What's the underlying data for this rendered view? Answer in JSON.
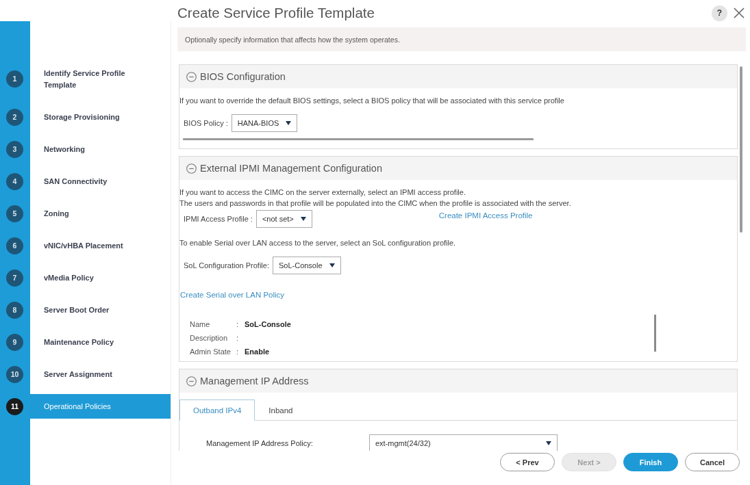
{
  "window": {
    "title": "Create Service Profile Template",
    "help_label": "?"
  },
  "steps": [
    {
      "number": "1",
      "label": "Identify Service Profile Template",
      "selected": false
    },
    {
      "number": "2",
      "label": "Storage Provisioning",
      "selected": false
    },
    {
      "number": "3",
      "label": "Networking",
      "selected": false
    },
    {
      "number": "4",
      "label": "SAN Connectivity",
      "selected": false
    },
    {
      "number": "5",
      "label": "Zoning",
      "selected": false
    },
    {
      "number": "6",
      "label": "vNIC/vHBA Placement",
      "selected": false
    },
    {
      "number": "7",
      "label": "vMedia Policy",
      "selected": false
    },
    {
      "number": "8",
      "label": "Server Boot Order",
      "selected": false
    },
    {
      "number": "9",
      "label": "Maintenance Policy",
      "selected": false
    },
    {
      "number": "10",
      "label": "Server Assignment",
      "selected": false
    },
    {
      "number": "11",
      "label": "Operational Policies",
      "selected": true
    }
  ],
  "info_bar": {
    "text": "Optionally specify information that affects how the system operates."
  },
  "sections": [
    {
      "title": "BIOS Configuration",
      "expanded": true,
      "blocks": [
        {
          "kind": "text",
          "text": "If you want to override the default BIOS settings, select a BIOS policy that will be associated with this service profile"
        },
        {
          "kind": "select",
          "label": "BIOS Policy :",
          "value": "HANA-BIOS"
        },
        {
          "kind": "hscroll"
        }
      ]
    },
    {
      "title": "External IPMI Management Configuration",
      "expanded": true,
      "blocks": [
        {
          "kind": "lines",
          "lines": [
            "If you want to access the CIMC on the server externally, select an IPMI access profile.",
            "The users and passwords in that profile will be populated into the CIMC when the profile is associated with the server."
          ]
        },
        {
          "kind": "select",
          "label": "IPMI Access Profile :",
          "value": "<not set>",
          "link": "Create IPMI Access Profile"
        },
        {
          "kind": "text",
          "text": "To enable Serial over LAN access to the server, select an SoL configuration profile."
        },
        {
          "kind": "select",
          "label": "SoL Configuration Profile:",
          "value": "SoL-Console"
        },
        {
          "kind": "link",
          "text": "Create Serial over LAN Policy"
        },
        {
          "kind": "details",
          "rows": [
            {
              "label": "Name",
              "separator": ":",
              "value": "SoL-Console"
            },
            {
              "label": "Description",
              "separator": ":"
            },
            {
              "label": "Admin State",
              "separator": ":",
              "value": "Enable"
            }
          ]
        }
      ]
    },
    {
      "title": "Management IP Address",
      "expanded": true,
      "blocks": [
        {
          "kind": "tabs",
          "tabs": [
            {
              "label": "Outband IPv4",
              "selected": true
            },
            {
              "label": "Inband",
              "selected": false
            }
          ]
        },
        {
          "kind": "form_row",
          "label": "Management IP Address Policy:",
          "value": "ext-mgmt(24/32)"
        }
      ]
    }
  ],
  "footer": {
    "buttons": [
      {
        "label": "< Prev",
        "kind": "secondary",
        "disabled": false
      },
      {
        "label": "Next >",
        "kind": "secondary",
        "disabled": true
      },
      {
        "label": "Finish",
        "kind": "primary",
        "disabled": false
      },
      {
        "label": "Cancel",
        "kind": "secondary",
        "disabled": false
      }
    ]
  }
}
